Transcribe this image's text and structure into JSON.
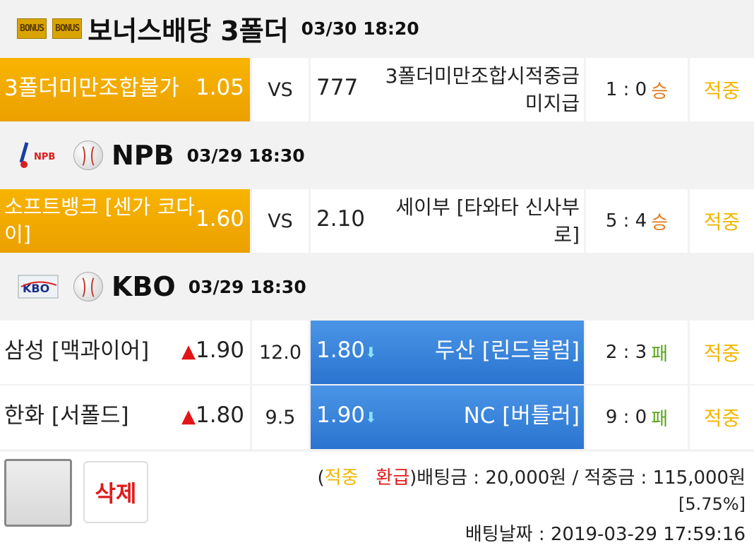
{
  "header1": {
    "badge1": "BONUS",
    "badge2": "BONUS",
    "title": "보너스배당 3폴더",
    "date": "03/30 18:20"
  },
  "row1": {
    "home": "3폴더미만조합불가",
    "home_odds": "1.05",
    "vs": "VS",
    "away_odds": "777",
    "away": "3폴더미만조합시적중금미지급",
    "score": "1 : 0",
    "result": "승",
    "status": "적중"
  },
  "header2": {
    "logo": "NPB",
    "title": "NPB",
    "date": "03/29 18:30"
  },
  "row2": {
    "home": "소프트뱅크 [센가 코다이]",
    "home_odds": "1.60",
    "vs": "VS",
    "away_odds": "2.10",
    "away": "세이부 [타와타 신사부로]",
    "score": "5 : 4",
    "result": "승",
    "status": "적중"
  },
  "header3": {
    "logo": "KBO",
    "title": "KBO",
    "date": "03/29 18:30"
  },
  "row3": {
    "home": "삼성 [맥과이어]",
    "home_odds": "1.90",
    "line": "12.0",
    "away_odds": "1.80",
    "away": "두산 [린드블럼]",
    "score": "2 : 3",
    "result": "패",
    "status": "적중"
  },
  "row4": {
    "home": "한화 [서폴드]",
    "home_odds": "1.80",
    "line": "9.5",
    "away_odds": "1.90",
    "away": "NC [버틀러]",
    "score": "9 : 0",
    "result": "패",
    "status": "적중"
  },
  "footer": {
    "delete_label": "삭제",
    "paren_open": "(",
    "hit_label": "적중",
    "refund_label": "환급",
    "paren_close": ")",
    "summary": "배팅금 : 20,000원 / 적중금 : 115,000원",
    "rate": "[5.75%]",
    "bet_date": "배팅날짜 : 2019-03-29 17:59:16"
  },
  "colors": {
    "orange": "#f8b400",
    "blue": "#2b74d0",
    "hit": "#f2b600",
    "win": "#e07a1c",
    "lose": "#5aa51c",
    "delete": "#e01a1a"
  },
  "icons": {
    "up_arrow": "arrow-up-icon",
    "down_arrow": "arrow-down-icon",
    "baseball": "baseball-icon"
  }
}
